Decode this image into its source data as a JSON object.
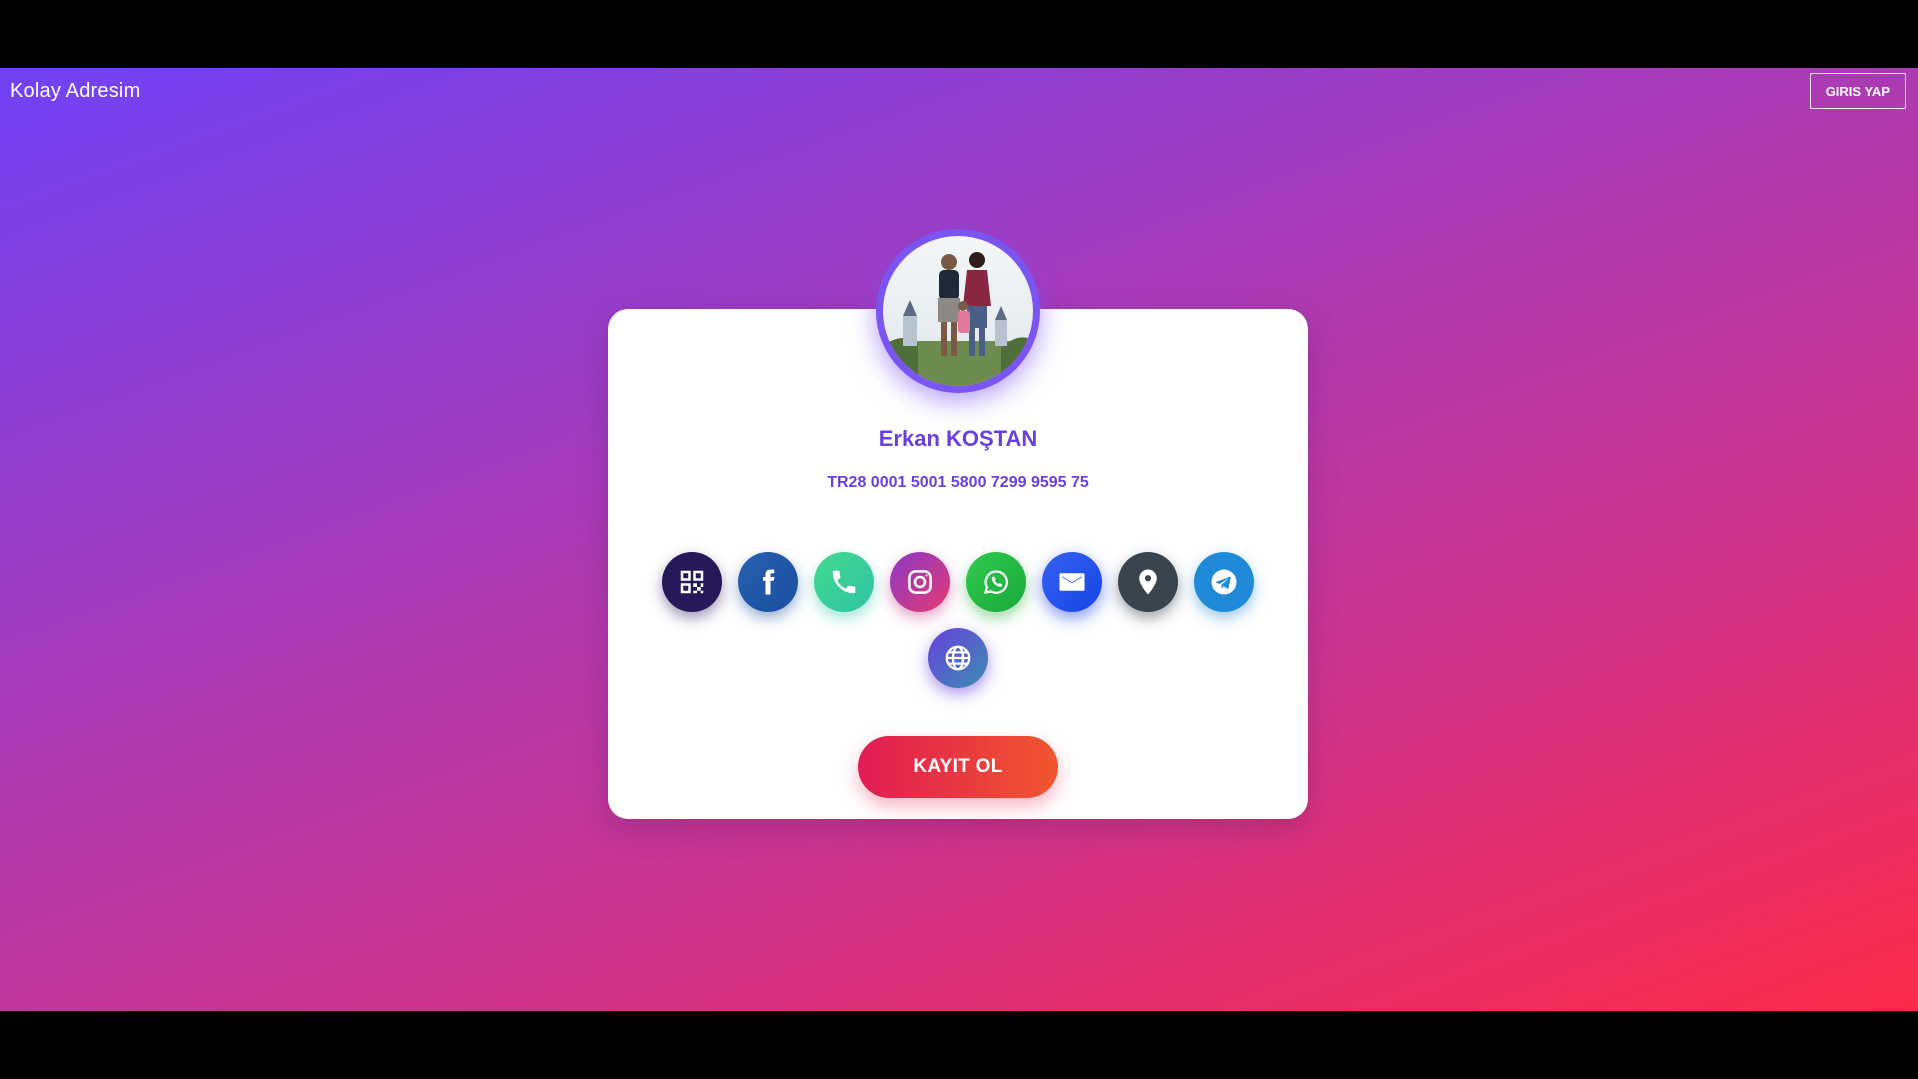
{
  "header": {
    "brand": "Kolay Adresim",
    "login_label": "GIRIS YAP"
  },
  "profile": {
    "name": "Erkan KOŞTAN",
    "iban": "TR28 0001 5001 5800 7299 9595 75"
  },
  "actions": [
    {
      "name": "qr-code",
      "icon": "qr-code-icon",
      "color": "#27185a"
    },
    {
      "name": "facebook",
      "icon": "facebook-icon",
      "color": "#1a4fa0"
    },
    {
      "name": "phone",
      "icon": "phone-icon",
      "color": "#2ec4a6"
    },
    {
      "name": "instagram",
      "icon": "instagram-icon",
      "color": "#c8327f"
    },
    {
      "name": "whatsapp",
      "icon": "whatsapp-icon",
      "color": "#1aa739"
    },
    {
      "name": "email",
      "icon": "mail-icon",
      "color": "#1745e6"
    },
    {
      "name": "location",
      "icon": "map-pin-icon",
      "color": "#39444d"
    },
    {
      "name": "telegram",
      "icon": "telegram-icon",
      "color": "#1e8ad8"
    },
    {
      "name": "website",
      "icon": "globe-icon",
      "color": "#6a3fe0"
    }
  ],
  "signup": {
    "label": "KAYIT OL"
  },
  "theme": {
    "gradient_start": "#6f42f5",
    "gradient_end": "#fd2b4c",
    "accent": "#6a3fe0"
  }
}
